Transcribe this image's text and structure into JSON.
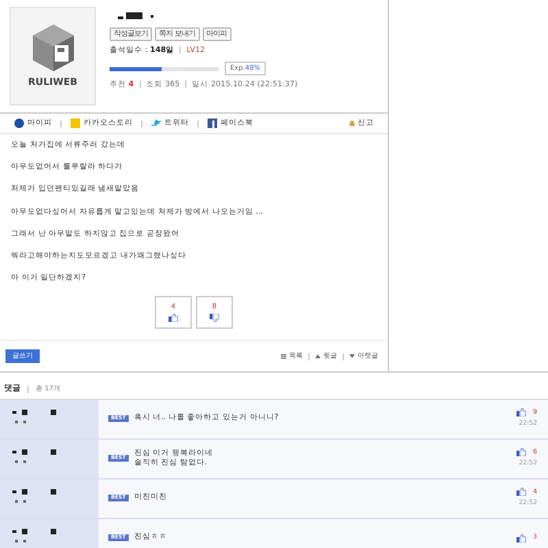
{
  "profile": {
    "logo_text": "RULIWEB",
    "buttons": [
      "작성글보기",
      "쪽지 보내기",
      "마이피"
    ],
    "attendance_label": "출석일수 : ",
    "attendance_value": "148일",
    "level_label": "LV12",
    "exp": {
      "level": 0.48,
      "label": "Exp.",
      "value": "48%"
    },
    "stats": [
      {
        "label": "추천",
        "value": "4",
        "highlight": true
      },
      {
        "label": "조회",
        "value": "365",
        "highlight": false
      },
      {
        "label": "일시",
        "value": "2015.10.24 (22:51:37)",
        "highlight": false
      }
    ]
  },
  "share": [
    {
      "label": "마이피",
      "kind": "mypi"
    },
    {
      "label": "카카오스토리",
      "kind": "kakao"
    },
    {
      "label": "트위터",
      "kind": "twitter"
    },
    {
      "label": "페이스북",
      "kind": "facebook"
    }
  ],
  "report": "신고",
  "body": [
    "오늘 처가집에 서류주러 갔는데",
    "아무도없어서 룰루랄라 하다가",
    "처제가 입던팬티있길래 냄새맡았음",
    "아무도없다싶어서 자유롭게 맡고있는데 처제가 방에서 나오는거임 ...",
    "그래서 난 아무말도 하지않고 집으로 곧장왔어",
    "뭐라고해야하는지도모르겠고 내가왜그랬나싶다",
    "아 이거 일단하겠지?"
  ],
  "votes": [
    {
      "kind": "up",
      "count": "4"
    },
    {
      "kind": "down",
      "count": "8"
    }
  ],
  "write_button": "글쓰기",
  "nav": [
    {
      "kind": "list",
      "label": "목록"
    },
    {
      "kind": "prev",
      "label": "윗글"
    },
    {
      "kind": "next",
      "label": "아랫글"
    }
  ],
  "comments_title": "댓글",
  "comments_count": "총 17개",
  "comments": [
    {
      "best": true,
      "best_label": "BEST",
      "lines": [
        "혹시 너.. 나를 좋아하고 있는거 아니니?"
      ],
      "likes": "9",
      "time": "22:52"
    },
    {
      "best": true,
      "best_label": "BEST",
      "lines": [
        "진심 이거 행복라이네",
        "솔직히 진심 탐없다."
      ],
      "likes": "6",
      "time": "22:52"
    },
    {
      "best": true,
      "best_label": "BEST",
      "lines": [
        "미친미친"
      ],
      "likes": "4",
      "time": "22:52"
    },
    {
      "best": true,
      "best_label": "BEST",
      "lines": [
        "진심ㅎㅎ"
      ],
      "likes": "3"
    }
  ]
}
